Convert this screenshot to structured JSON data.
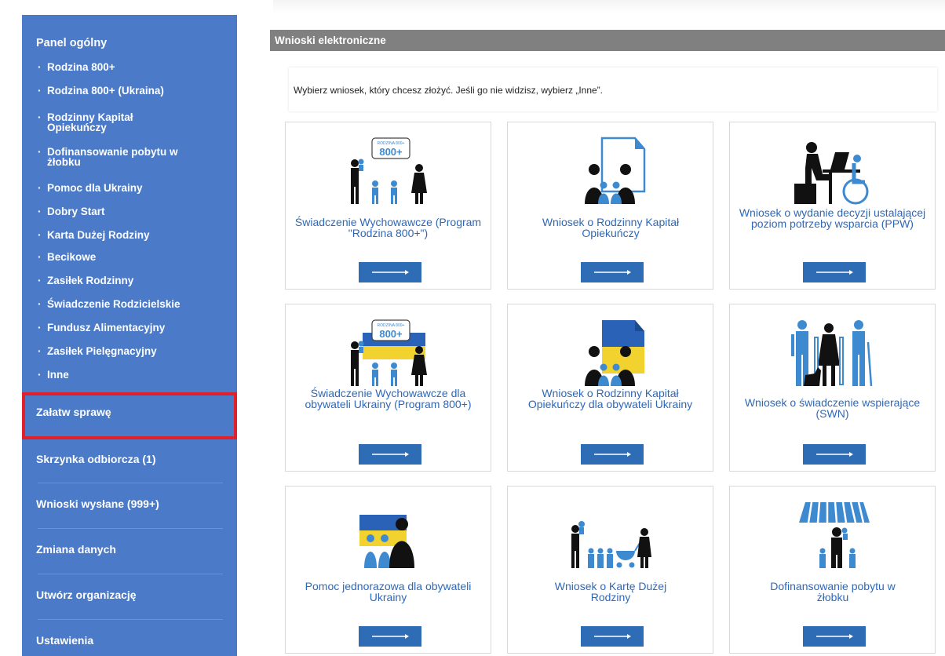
{
  "sidebar": {
    "panel_title": "Panel ogólny",
    "bullet": "·",
    "subitems": [
      "Rodzina 800+",
      "Rodzina 800+ (Ukraina)",
      "Rodzinny Kapitał Opiekuńczy",
      "Dofinansowanie pobytu w żłobku",
      "Pomoc dla Ukrainy",
      "Dobry Start",
      "Karta Dużej Rodziny",
      "Becikowe",
      "Zasiłek Rodzinny",
      "Świadczenie Rodzicielskie",
      "Fundusz Alimentacyjny",
      "Zasiłek Pielęgnacyjny",
      "Inne"
    ],
    "menu": [
      "Załatw sprawę",
      "Skrzynka odbiorcza (1)",
      "Wnioski wysłane (999+)",
      "Zmiana danych",
      "Utwórz organizację",
      "Ustawienia"
    ]
  },
  "main": {
    "header": "Wnioski elektroniczne",
    "instruction": "Wybierz wniosek, który chcesz złożyć. Jeśli go nie widzisz, wybierz „Inne”.",
    "cards": [
      {
        "title": "Świadczenie Wychowawcze (Program \"Rodzina 800+\")",
        "icon": "family-800-icon"
      },
      {
        "title": "Wniosek o Rodzinny Kapitał Opiekuńczy",
        "icon": "family-document-icon"
      },
      {
        "title": "Wniosek o wydanie decyzji ustalającej poziom potrzeby wsparcia (PPW)",
        "icon": "wheelchair-office-icon"
      },
      {
        "title": "Świadczenie Wychowawcze dla obywateli Ukrainy (Program 800+)",
        "icon": "family-800-ukraine-icon"
      },
      {
        "title": "Wniosek o Rodzinny Kapitał Opiekuńczy dla obywateli Ukrainy",
        "icon": "family-ukraine-document-icon"
      },
      {
        "title": "Wniosek o świadczenie wspierające (SWN)",
        "icon": "disability-support-icon"
      },
      {
        "title": "Pomoc jednorazowa dla obywateli Ukrainy",
        "icon": "ukraine-family-icon"
      },
      {
        "title": "Wniosek o Kartę Dużej Rodziny",
        "icon": "large-family-stroller-icon"
      },
      {
        "title": "Dofinansowanie pobytu w żłobku",
        "icon": "nursery-awning-icon"
      }
    ],
    "card_badge": "RODZINA 800+"
  },
  "colors": {
    "sidebar_bg": "#4a7ac8",
    "header_bg": "#808080",
    "card_title": "#2e68b8",
    "button_bg": "#2f6cb6",
    "highlight_border": "#e0202a",
    "ukraine_blue": "#2a62b8",
    "ukraine_yellow": "#f2d22e",
    "figure_blue": "#3d8ad0"
  }
}
